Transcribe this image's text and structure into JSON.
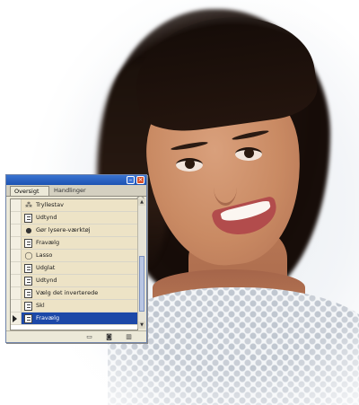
{
  "palette": {
    "tabs": [
      {
        "label": "Oversigt"
      },
      {
        "label": "Handlinger"
      }
    ],
    "minimize_glyph": "–",
    "close_glyph": "×",
    "menu_glyph": "▸",
    "history": [
      {
        "label": "Tryllestav",
        "icon": "magic-wand-icon",
        "glyph": "⁂"
      },
      {
        "label": "Udtynd",
        "icon": "document-icon"
      },
      {
        "label": "Gør lysere-værktøj",
        "icon": "dodge-tool-icon",
        "glyph": "●"
      },
      {
        "label": "Fravælg",
        "icon": "document-icon"
      },
      {
        "label": "Lasso",
        "icon": "lasso-icon",
        "glyph": "◯"
      },
      {
        "label": "Udglat",
        "icon": "document-icon"
      },
      {
        "label": "Udtynd",
        "icon": "document-icon"
      },
      {
        "label": "Vælg det inverterede",
        "icon": "document-icon"
      },
      {
        "label": "Skl",
        "icon": "document-icon"
      },
      {
        "label": "Fravælg",
        "icon": "document-icon",
        "selected": true
      }
    ],
    "bottom_buttons": [
      {
        "name": "new-document-button",
        "icon": "new-document-icon",
        "glyph": "▭"
      },
      {
        "name": "new-snapshot-button",
        "icon": "camera-icon",
        "glyph": "◙"
      },
      {
        "name": "delete-state-button",
        "icon": "trash-icon",
        "glyph": "▥"
      }
    ],
    "selected_color": "#1c48a8",
    "row_color": "#ede3c6"
  }
}
